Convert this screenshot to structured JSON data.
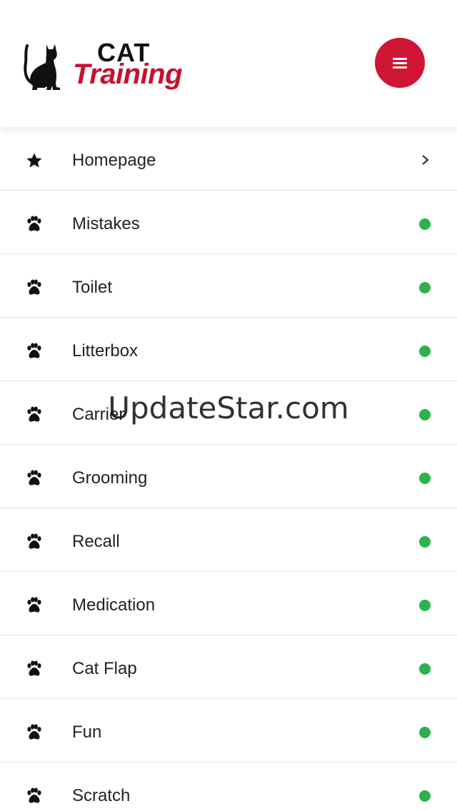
{
  "header": {
    "logo_text_top": "CAT",
    "logo_text_bottom": "Training",
    "menu_icon": "hamburger-icon",
    "accent_color": "#cf1533"
  },
  "nav": {
    "items": [
      {
        "label": "Homepage",
        "icon": "star-icon",
        "indicator": "chevron-right"
      },
      {
        "label": "Mistakes",
        "icon": "paw-icon",
        "indicator": "green-dot"
      },
      {
        "label": "Toilet",
        "icon": "paw-icon",
        "indicator": "green-dot"
      },
      {
        "label": "Litterbox",
        "icon": "paw-icon",
        "indicator": "green-dot"
      },
      {
        "label": "Carrier",
        "icon": "paw-icon",
        "indicator": "green-dot"
      },
      {
        "label": "Grooming",
        "icon": "paw-icon",
        "indicator": "green-dot"
      },
      {
        "label": "Recall",
        "icon": "paw-icon",
        "indicator": "green-dot"
      },
      {
        "label": "Medication",
        "icon": "paw-icon",
        "indicator": "green-dot"
      },
      {
        "label": "Cat Flap",
        "icon": "paw-icon",
        "indicator": "green-dot"
      },
      {
        "label": "Fun",
        "icon": "paw-icon",
        "indicator": "green-dot"
      },
      {
        "label": "Scratch",
        "icon": "paw-icon",
        "indicator": "green-dot"
      }
    ],
    "dot_color": "#2bb24c"
  },
  "watermark": {
    "text": "UpdateStar.com"
  }
}
